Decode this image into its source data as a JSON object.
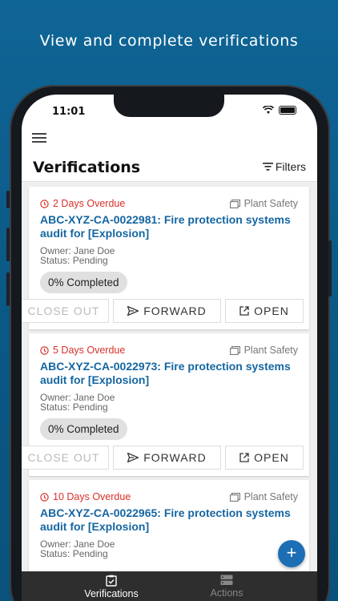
{
  "headline": "View and complete verifications",
  "status_bar": {
    "time": "11:01"
  },
  "header": {
    "title": "Verifications",
    "filters_label": "Filters"
  },
  "cards": [
    {
      "overdue": "2 Days Overdue",
      "category": "Plant Safety",
      "title": "ABC-XYZ-CA-0022981: Fire protection systems audit for [Explosion]",
      "owner": "Owner: Jane Doe",
      "status": "Status: Pending",
      "progress": "0% Completed",
      "close_label": "CLOSE OUT",
      "forward_label": "FORWARD",
      "open_label": "OPEN"
    },
    {
      "overdue": "5 Days Overdue",
      "category": "Plant Safety",
      "title": "ABC-XYZ-CA-0022973: Fire protection systems audit for [Explosion]",
      "owner": "Owner: Jane Doe",
      "status": "Status: Pending",
      "progress": "0% Completed",
      "close_label": "CLOSE OUT",
      "forward_label": "FORWARD",
      "open_label": "OPEN"
    },
    {
      "overdue": "10 Days Overdue",
      "category": "Plant Safety",
      "title": "ABC-XYZ-CA-0022965: Fire protection systems audit for [Explosion]",
      "owner": "Owner: Jane Doe",
      "status": "Status: Pending"
    }
  ],
  "fab": {
    "label": "+"
  },
  "tabs": [
    {
      "label": "Verifications",
      "icon": "clipboard-check-icon",
      "active": true
    },
    {
      "label": "Actions",
      "icon": "server-icon",
      "active": false
    }
  ],
  "colors": {
    "background": "#0b5a87",
    "accent": "#1566a1",
    "overdue": "#d9302a",
    "tabbar": "#2e2e2e"
  }
}
